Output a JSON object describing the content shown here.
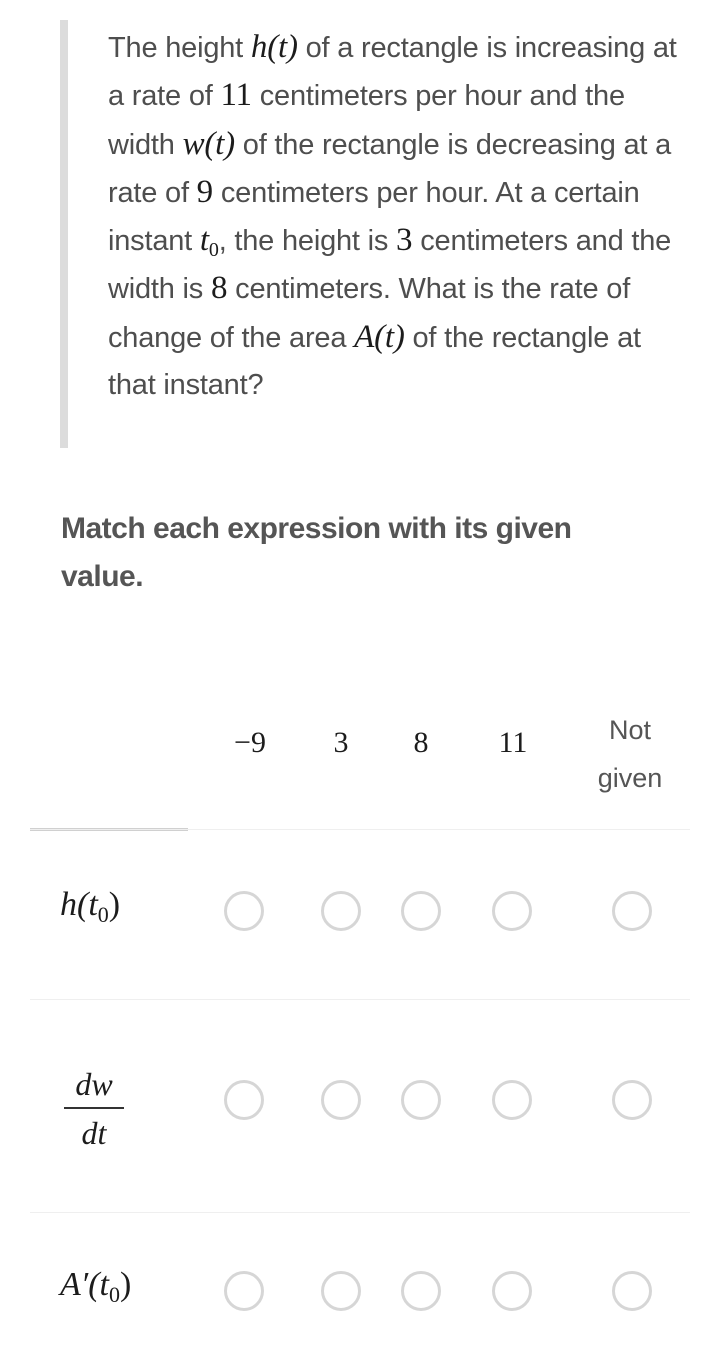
{
  "question": {
    "segments": [
      {
        "t": "The height "
      },
      {
        "m": "h(t)"
      },
      {
        "t": " of a rectangle is increasing at a rate of "
      },
      {
        "n": "11"
      },
      {
        "t": " centimeters per hour and the width "
      },
      {
        "m": "w(t)"
      },
      {
        "t": " of the rectangle is decreasing at a rate of "
      },
      {
        "n": "9"
      },
      {
        "t": " centimeters per hour. At a certain instant "
      },
      {
        "m": "t",
        "sub": "0"
      },
      {
        "t": ", the height is "
      },
      {
        "n": "3"
      },
      {
        "t": " centimeters and the width is "
      },
      {
        "n": "8"
      },
      {
        "t": " centimeters. What is the rate of change of the area "
      },
      {
        "m": "A(t)"
      },
      {
        "t": " of the rectangle at that instant?"
      }
    ]
  },
  "instruction": "Match each expression with its given value.",
  "matrix": {
    "columns": [
      "−9",
      "3",
      "8",
      "11",
      "Not given"
    ],
    "rows": [
      {
        "id": "h-t0",
        "label_main": "h(t",
        "label_sub": "0",
        "label_end": ")",
        "selected": null
      },
      {
        "id": "dw-dt",
        "numerator": "dw",
        "denominator": "dt",
        "selected": null
      },
      {
        "id": "a-prime-t0",
        "label_main": "A′(t",
        "label_sub": "0",
        "label_end": ")",
        "selected": null
      }
    ]
  },
  "colors": {
    "radio_border": "#d6d6d6",
    "quote_bar": "#dcdcdc",
    "text": "#4e4e4e"
  }
}
